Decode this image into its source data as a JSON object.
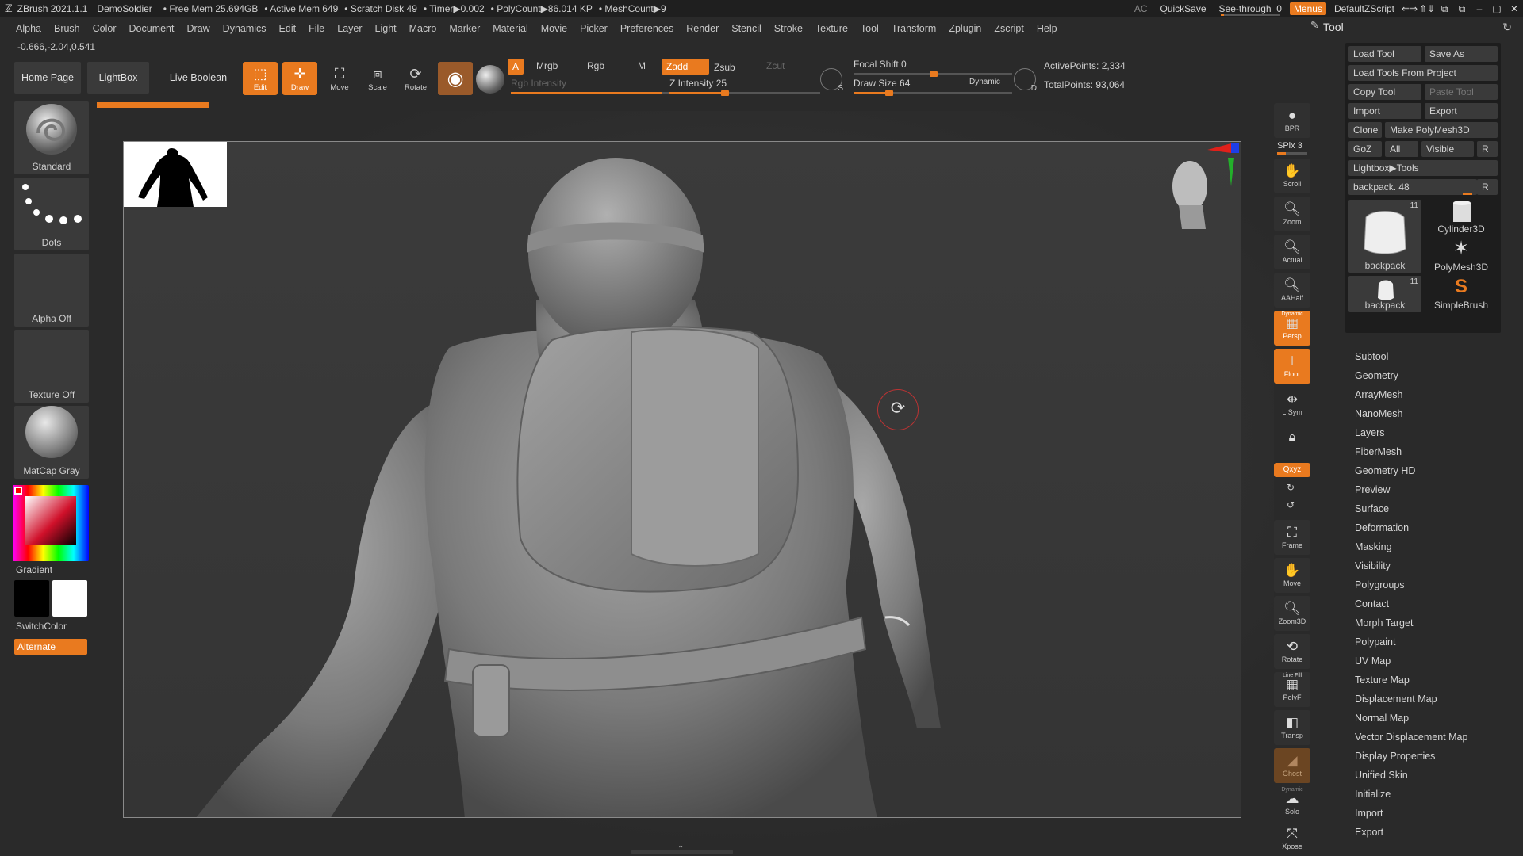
{
  "app": {
    "title": "ZBrush 2021.1.1",
    "project": "DemoSoldier",
    "stats": [
      "• Free Mem 25.694GB",
      "• Active Mem 649",
      "• Scratch Disk 49",
      "• Timer▶0.002",
      "• PolyCount▶86.014 KP",
      "• MeshCount▶9"
    ]
  },
  "titlebar_right": {
    "ac": "AC",
    "quicksave": "QuickSave",
    "see_through_label": "See-through",
    "see_through_value": "0",
    "see_through_level": 0,
    "menus": "Menus",
    "script": "DefaultZScript",
    "win_buttons": [
      "⇐⇒",
      "⇑⇓",
      "⧉",
      "⧉",
      "–",
      "▢",
      "✕"
    ]
  },
  "menubar": [
    "Alpha",
    "Brush",
    "Color",
    "Document",
    "Draw",
    "Dynamics",
    "Edit",
    "File",
    "Layer",
    "Light",
    "Macro",
    "Marker",
    "Material",
    "Movie",
    "Picker",
    "Preferences",
    "Render",
    "Stencil",
    "Stroke",
    "Texture",
    "Tool",
    "Transform",
    "Zplugin",
    "Zscript",
    "Help"
  ],
  "coords": "-0.666,-2.04,0.541",
  "toolbar": {
    "home": "Home Page",
    "lightbox": "LightBox",
    "live_boolean": "Live Boolean",
    "edit": "Edit",
    "draw": "Draw",
    "move": "Move",
    "scale": "Scale",
    "rotate": "Rotate",
    "a": "A",
    "mrgb": "Mrgb",
    "rgb": "Rgb",
    "m": "M",
    "rgb_intensity": "Rgb Intensity",
    "zadd": "Zadd",
    "zsub": "Zsub",
    "zcut": "Zcut",
    "z_intensity_label": "Z Intensity",
    "z_intensity": "25",
    "focal_shift_label": "Focal Shift",
    "focal_shift": "0",
    "draw_size_label": "Draw Size",
    "draw_size": "64",
    "dynamic": "Dynamic",
    "active_points": "ActivePoints: 2,334",
    "total_points": "TotalPoints: 93,064",
    "s_icon_letter": "S",
    "d_icon_letter": "D"
  },
  "left_palette": {
    "brush": "Standard",
    "stroke": "Dots",
    "alpha": "Alpha Off",
    "texture": "Texture Off",
    "material": "MatCap Gray",
    "gradient": "Gradient",
    "switchcolor": "SwitchColor",
    "alternate": "Alternate"
  },
  "shelf": {
    "bpr": "BPR",
    "spix": "SPix 3",
    "scroll": "Scroll",
    "zoom": "Zoom",
    "actual": "Actual",
    "aahalf": "AAHalf",
    "dynamic_hdr": "Dynamic",
    "persp": "Persp",
    "floor": "Floor",
    "lsym": "L.Sym",
    "xyz": "Qxyz",
    "frame": "Frame",
    "move": "Move",
    "zoom3d": "Zoom3D",
    "rotate": "Rotate",
    "linefill": "Line Fill",
    "polyf": "PolyF",
    "transp": "Transp",
    "ghost": "Ghost",
    "dynamic2": "Dynamic",
    "solo": "Solo",
    "xpose": "Xpose"
  },
  "tool_panel": {
    "header": "Tool",
    "load_tool": "Load Tool",
    "save_as": "Save As",
    "load_from_project": "Load Tools From Project",
    "copy_tool": "Copy Tool",
    "paste_tool": "Paste Tool",
    "import": "Import",
    "export": "Export",
    "clone": "Clone",
    "make_polymesh": "Make PolyMesh3D",
    "goz": "GoZ",
    "all": "All",
    "visible": "Visible",
    "r": "R",
    "lightbox_tools": "Lightbox▶Tools",
    "current_tool": "backpack. 48",
    "current_tool_r": "R",
    "tiles": [
      {
        "name": "backpack",
        "count": "11"
      },
      {
        "name": "Cylinder3D",
        "count": ""
      },
      {
        "name": "PolyMesh3D",
        "count": ""
      },
      {
        "name": "backpack",
        "count": "11"
      },
      {
        "name": "SimpleBrush",
        "count": ""
      }
    ],
    "subpalettes": [
      "Subtool",
      "Geometry",
      "ArrayMesh",
      "NanoMesh",
      "Layers",
      "FiberMesh",
      "Geometry HD",
      "Preview",
      "Surface",
      "Deformation",
      "Masking",
      "Visibility",
      "Polygroups",
      "Contact",
      "Morph Target",
      "Polypaint",
      "UV Map",
      "Texture Map",
      "Displacement Map",
      "Normal Map",
      "Vector Displacement Map",
      "Display Properties",
      "Unified Skin",
      "Initialize",
      "Import",
      "Export"
    ]
  }
}
